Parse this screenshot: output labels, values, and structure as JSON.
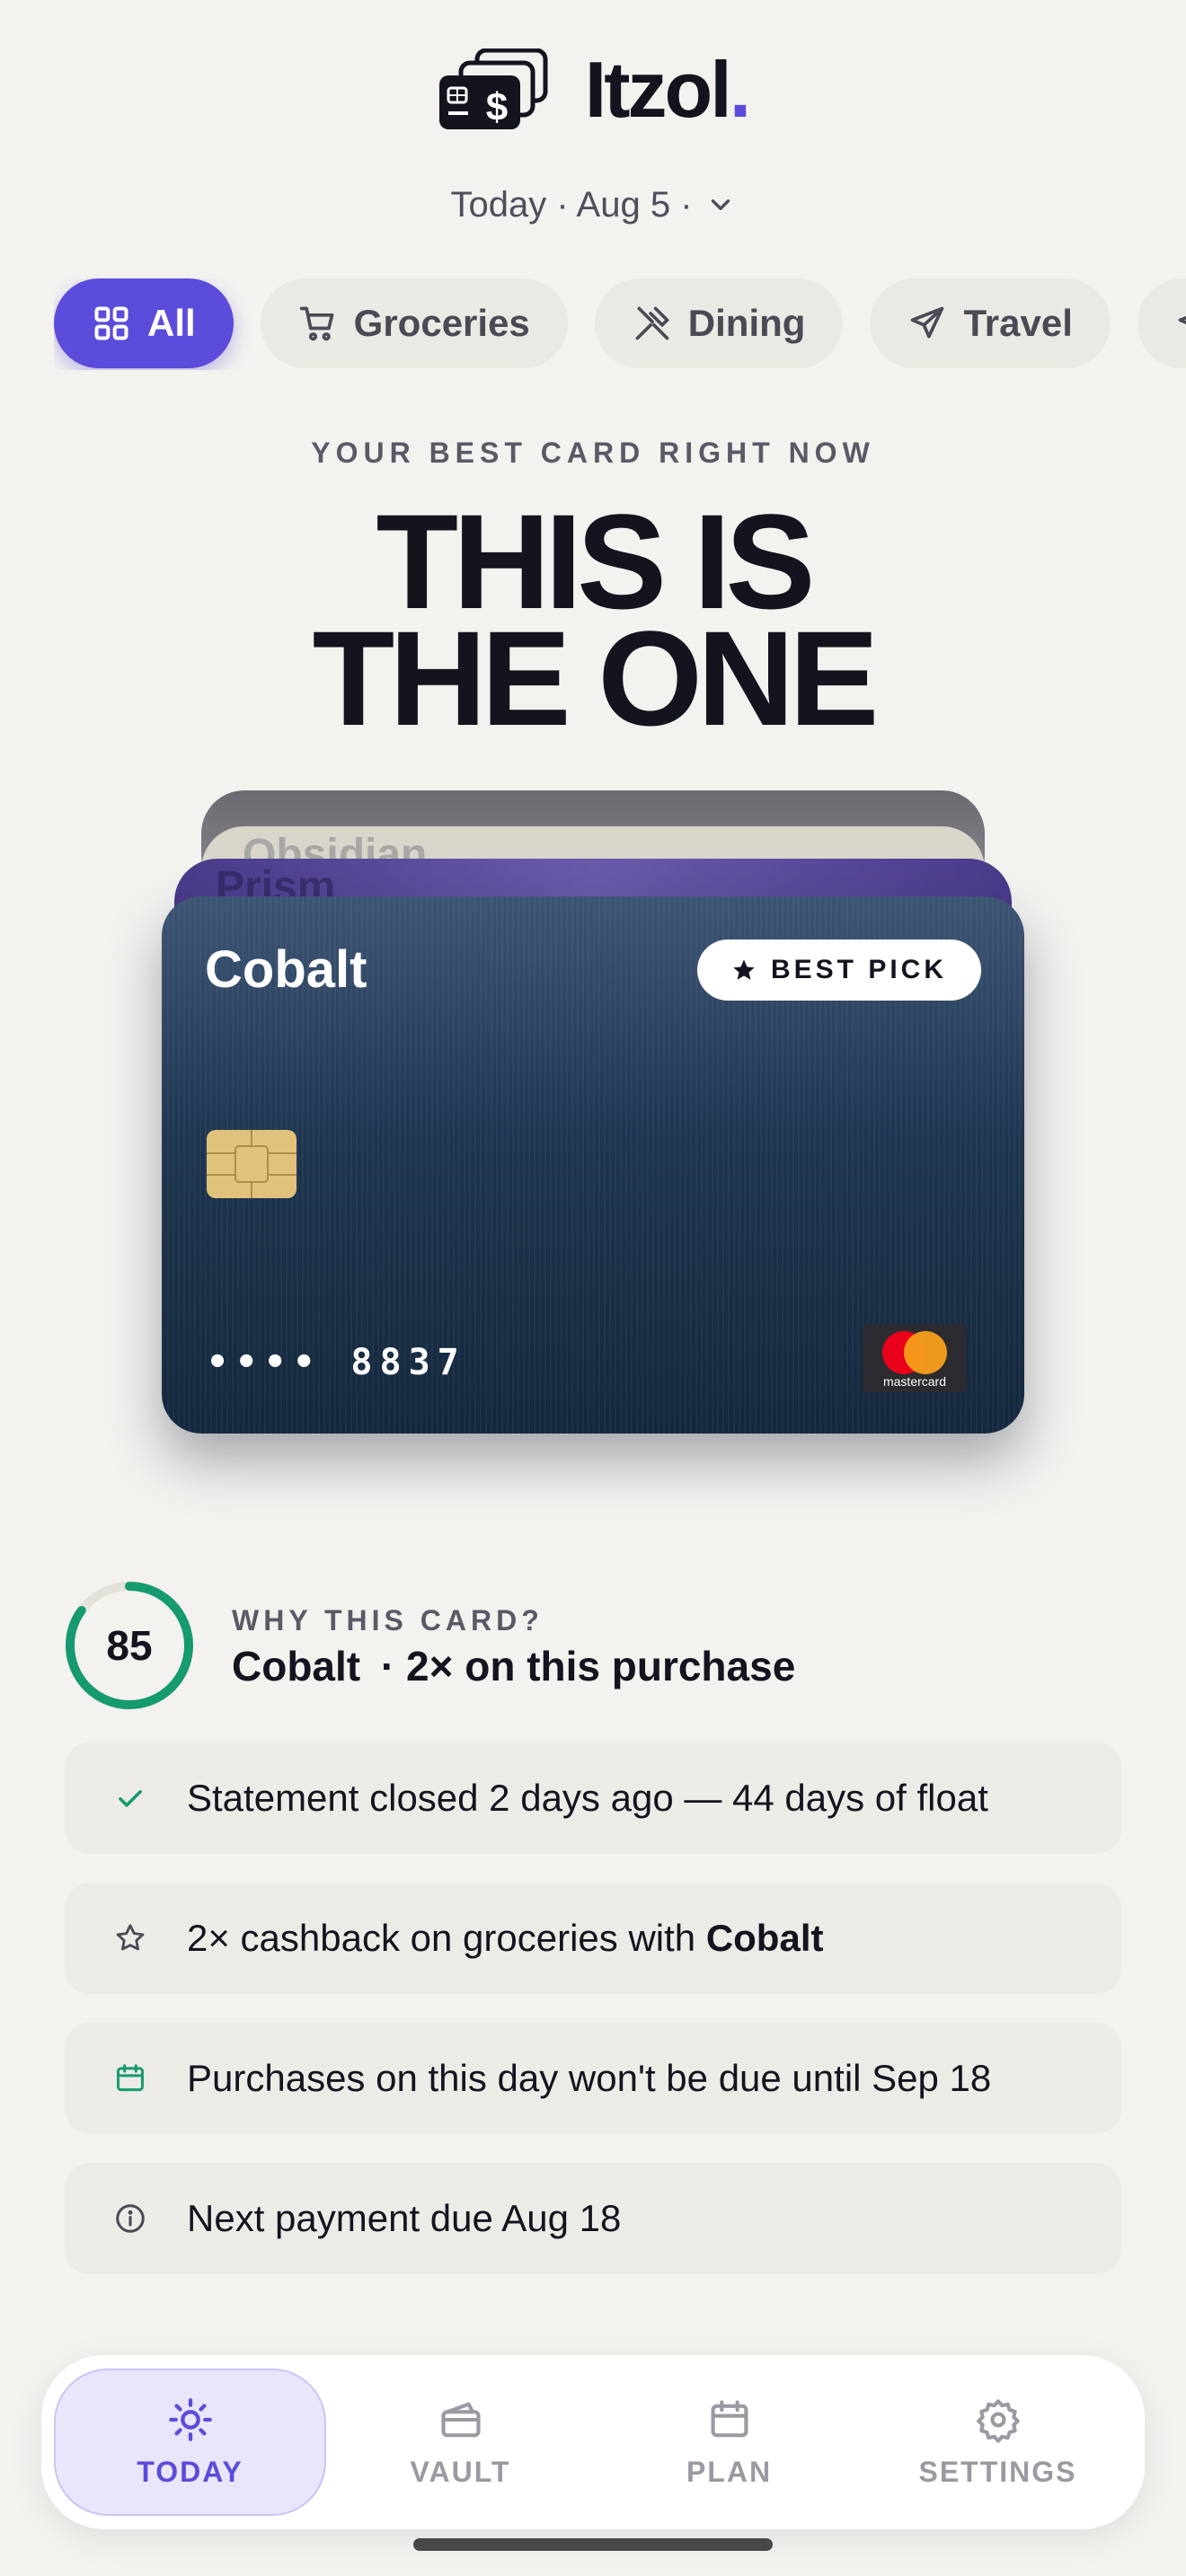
{
  "app": {
    "name": "Itzol",
    "name_dot": "."
  },
  "date_selector": {
    "label": "Today · Aug 5 ·"
  },
  "filters": [
    {
      "label": "All",
      "icon": "grid-icon",
      "active": true
    },
    {
      "label": "Groceries",
      "icon": "cart-icon",
      "active": false
    },
    {
      "label": "Dining",
      "icon": "utensils-icon",
      "active": false
    },
    {
      "label": "Travel",
      "icon": "plane-icon",
      "active": false
    },
    {
      "label": "",
      "icon": "plane-icon",
      "active": false
    }
  ],
  "hero": {
    "eyebrow": "YOUR BEST CARD RIGHT NOW",
    "headline_line1": "THIS IS",
    "headline_line2": "THE ONE"
  },
  "stack": {
    "back_cards": [
      "Obsidian",
      "Prism"
    ],
    "main_card": {
      "name": "Cobalt",
      "badge": "BEST PICK",
      "number": "•••• 8837",
      "network": "mastercard"
    }
  },
  "why": {
    "score": "85",
    "score_fraction": 0.85,
    "eyebrow": "WHY THIS CARD?",
    "card_name": "Cobalt",
    "summary": "· 2× on this purchase"
  },
  "reasons": [
    {
      "icon": "check-icon",
      "text": "Statement closed 2 days ago — 44 days of float"
    },
    {
      "icon": "star-icon",
      "text_before": "2× cashback on groceries with ",
      "text_bold": "Cobalt"
    },
    {
      "icon": "calendar-icon",
      "text": "Purchases on this day won't be due until Sep 18"
    },
    {
      "icon": "info-icon",
      "text": "Next payment due Aug 18"
    }
  ],
  "nav": [
    {
      "label": "TODAY",
      "icon": "sun-icon",
      "active": true
    },
    {
      "label": "VAULT",
      "icon": "wallet-icon",
      "active": false
    },
    {
      "label": "PLAN",
      "icon": "calendar-icon",
      "active": false
    },
    {
      "label": "SETTINGS",
      "icon": "gear-icon",
      "active": false
    }
  ],
  "colors": {
    "accent": "#5b4cdb",
    "success": "#169a70",
    "background": "#f3f2ef",
    "card": "#1f3650"
  }
}
